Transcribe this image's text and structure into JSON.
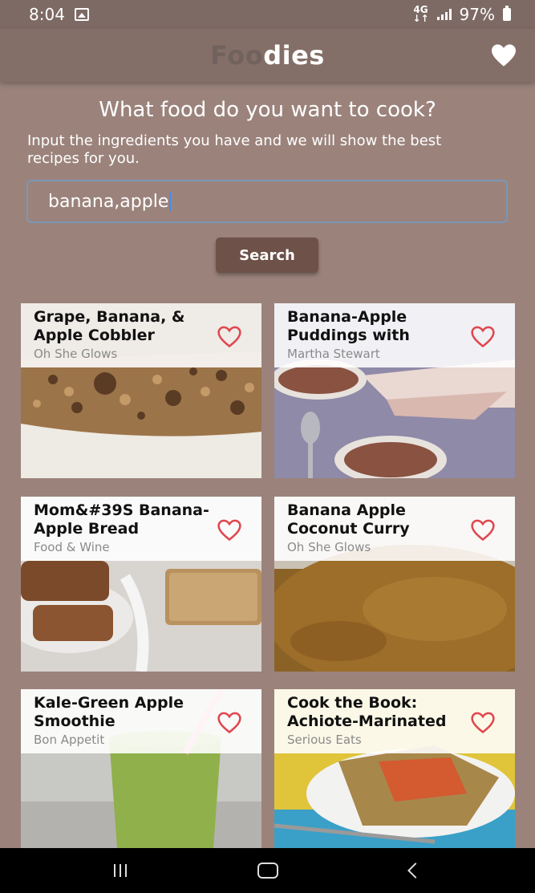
{
  "status_bar": {
    "time": "8:04",
    "network_top": "4G",
    "network_bottom": "↓↑",
    "battery": "97%"
  },
  "app_bar": {
    "title_part1": "Foo",
    "title_part2": "dies",
    "favorites_icon": "heart-icon"
  },
  "search_section": {
    "headline": "What food do you want to cook?",
    "subtext": "Input the ingredients you have and we will show the best recipes for you.",
    "input_value": "banana,apple",
    "button_label": "Search"
  },
  "recipes": [
    {
      "title": "Grape, Banana, & Apple Cobbler",
      "source": "Oh She Glows",
      "image": "granola-cobbler"
    },
    {
      "title": "Banana-Apple Puddings with Toast...",
      "source": "Martha Stewart",
      "image": "pudding-bowls"
    },
    {
      "title": "Mom&#39S Banana-Apple Bread",
      "source": "Food & Wine",
      "image": "banana-bread"
    },
    {
      "title": "Banana Apple Coconut Curry recipes",
      "source": "Oh She Glows",
      "image": "curry"
    },
    {
      "title": "Kale-Green Apple Smoothie",
      "source": "Bon Appetit",
      "image": "green-smoothie"
    },
    {
      "title": "Cook the Book: Achiote-Marinated C...",
      "source": "Serious Eats",
      "image": "achiote-dish"
    }
  ],
  "colors": {
    "background": "#9b837c",
    "app_bar": "#846f68",
    "button": "#6e5148",
    "heart_outline": "#e0474f"
  },
  "nav_bar": {
    "icons": [
      "recents-icon",
      "home-icon",
      "back-icon"
    ]
  }
}
